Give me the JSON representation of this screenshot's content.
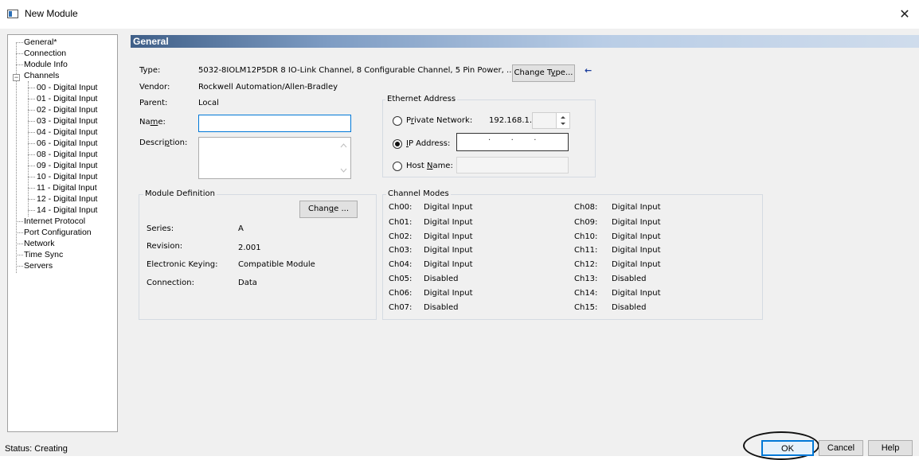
{
  "window": {
    "title": "New Module",
    "close": "✕"
  },
  "tree": {
    "items": [
      "General*",
      "Connection",
      "Module Info",
      "Channels",
      "00 - Digital Input",
      "01 - Digital Input",
      "02 - Digital Input",
      "03 - Digital Input",
      "04 - Digital Input",
      "06 - Digital Input",
      "08 - Digital Input",
      "09 - Digital Input",
      "10 - Digital Input",
      "11 - Digital Input",
      "12 - Digital Input",
      "14 - Digital Input",
      "Internet Protocol",
      "Port Configuration",
      "Network",
      "Time Sync",
      "Servers"
    ],
    "expander": "−"
  },
  "general": {
    "header": "General",
    "type_label": "Type:",
    "type_value": "5032-8IOLM12P5DR 8 IO-Link Channel, 8 Configurable Channel, 5 Pin Power, ...",
    "change_type_pre": "Change T",
    "change_type_ul": "y",
    "change_type_post": "pe...",
    "arrow": "←",
    "vendor_label": "Vendor:",
    "vendor_value": "Rockwell Automation/Allen-Bradley",
    "parent_label": "Parent:",
    "parent_value": "Local",
    "name_pre": "Na",
    "name_ul": "m",
    "name_post": "e:",
    "name_value": "",
    "description_pre": "Descri",
    "description_ul": "p",
    "description_post": "tion:",
    "description_value": ""
  },
  "ethernet": {
    "title": "Ethernet Address",
    "private_pre": "P",
    "private_ul": "r",
    "private_post": "ivate Network:",
    "private_prefix": "192.168.1.",
    "private_value": "",
    "ip_ul": "I",
    "ip_post": "P Address:",
    "ip_dots": "·        ·        ·",
    "host_pre": "Host ",
    "host_ul": "N",
    "host_post": "ame:",
    "host_value": "",
    "selected": "ip"
  },
  "module_definition": {
    "title": "Module Definition",
    "change_pre": "Chan",
    "change_ul": "g",
    "change_post": "e ...",
    "rows": [
      {
        "label": "Series:",
        "value": "A"
      },
      {
        "label": "Revision:",
        "value": "2.001"
      },
      {
        "label": "Electronic Keying:",
        "value": "Compatible Module"
      },
      {
        "label": "Connection:",
        "value": "Data"
      }
    ]
  },
  "channel_modes": {
    "title": "Channel Modes",
    "left": [
      {
        "ch": "Ch00:",
        "mode": "Digital Input"
      },
      {
        "ch": "Ch01:",
        "mode": "Digital Input"
      },
      {
        "ch": "Ch02:",
        "mode": "Digital Input"
      },
      {
        "ch": "Ch03:",
        "mode": "Digital Input"
      },
      {
        "ch": "Ch04:",
        "mode": "Digital Input"
      },
      {
        "ch": "Ch05:",
        "mode": "Disabled"
      },
      {
        "ch": "Ch06:",
        "mode": "Digital Input"
      },
      {
        "ch": "Ch07:",
        "mode": "Disabled"
      }
    ],
    "right": [
      {
        "ch": "Ch08:",
        "mode": "Digital Input"
      },
      {
        "ch": "Ch09:",
        "mode": "Digital Input"
      },
      {
        "ch": "Ch10:",
        "mode": "Digital Input"
      },
      {
        "ch": "Ch11:",
        "mode": "Digital Input"
      },
      {
        "ch": "Ch12:",
        "mode": "Digital Input"
      },
      {
        "ch": "Ch13:",
        "mode": "Disabled"
      },
      {
        "ch": "Ch14:",
        "mode": "Digital Input"
      },
      {
        "ch": "Ch15:",
        "mode": "Disabled"
      }
    ]
  },
  "footer": {
    "status": "Status: Creating",
    "ok": "OK",
    "cancel": "Cancel",
    "help": "Help"
  }
}
